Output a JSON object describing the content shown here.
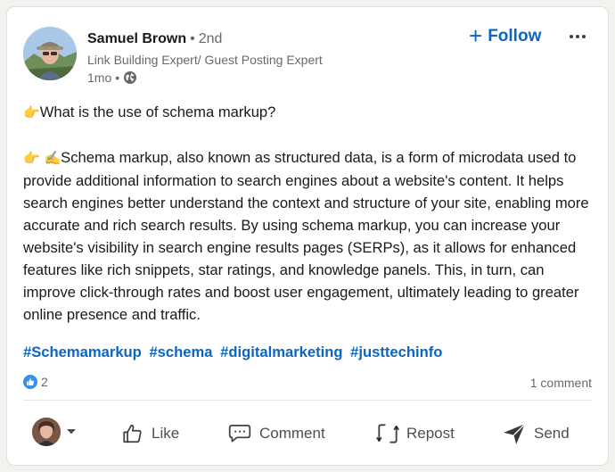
{
  "author": {
    "name": "Samuel Brown",
    "separator": "•",
    "degree": "2nd",
    "headline": "Link Building Expert/ Guest Posting Expert",
    "time": "1mo",
    "meta_separator": "•",
    "visibility_icon": "globe-icon"
  },
  "header_actions": {
    "follow_label": "Follow",
    "follow_icon": "plus-icon",
    "more_icon": "more-options-icon"
  },
  "post": {
    "question_emoji": "👉",
    "question": "What is the use of schema markup?",
    "answer_emoji": "👉 ✍️",
    "answer": "Schema markup, also known as structured data, is a form of microdata used to provide additional information to search engines about a website's content. It helps search engines better understand the context and structure of your site, enabling more accurate and rich search results. By using schema markup, you can increase your website's visibility in search engine results pages (SERPs), as it allows for enhanced features like rich snippets, star ratings, and knowledge panels. This, in turn, can improve click-through rates and boost user engagement, ultimately leading to greater online presence and traffic.",
    "hashtags": [
      "#Schemamarkup",
      "#schema",
      "#digitalmarketing",
      "#justtechinfo"
    ]
  },
  "social": {
    "reaction_icon": "like-reaction-icon",
    "reaction_count": "2",
    "comment_count": "1 comment"
  },
  "action_bar": {
    "like_label": "Like",
    "comment_label": "Comment",
    "repost_label": "Repost",
    "send_label": "Send"
  },
  "colors": {
    "accent": "#0a66c2",
    "like_badge": "#378fe9",
    "card_bg": "#ffffff",
    "page_bg": "#f3f2ef"
  }
}
